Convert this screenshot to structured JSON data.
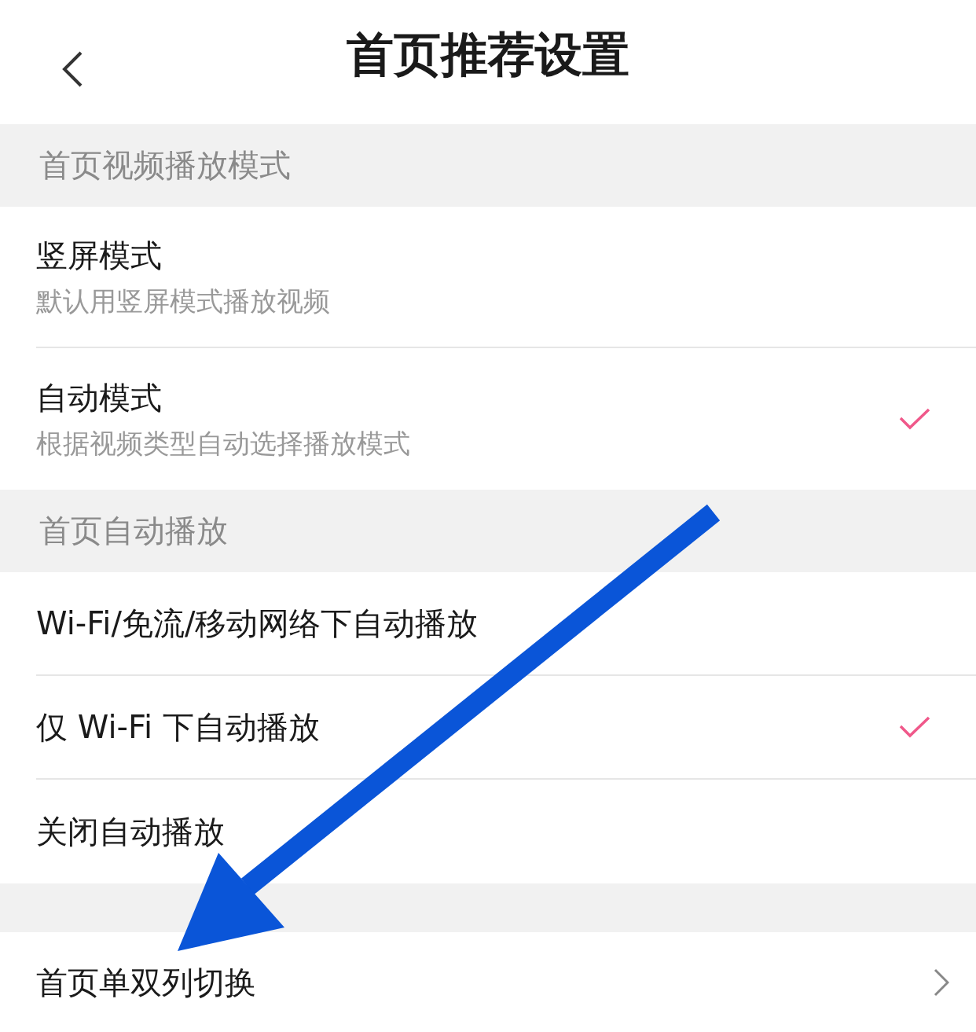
{
  "header": {
    "title": "首页推荐设置"
  },
  "sections": [
    {
      "header": "首页视频播放模式",
      "items": [
        {
          "kind": "choice",
          "title": "竖屏模式",
          "subtitle": "默认用竖屏模式播放视频",
          "selected": false
        },
        {
          "kind": "choice",
          "title": "自动模式",
          "subtitle": "根据视频类型自动选择播放模式",
          "selected": true
        }
      ]
    },
    {
      "header": "首页自动播放",
      "items": [
        {
          "kind": "choice",
          "title": "Wi-Fi/免流/移动网络下自动播放",
          "selected": false
        },
        {
          "kind": "choice",
          "title": "仅 Wi-Fi 下自动播放",
          "selected": true
        },
        {
          "kind": "choice",
          "title": "关闭自动播放",
          "selected": false
        }
      ]
    },
    {
      "items": [
        {
          "kind": "link",
          "title": "首页单双列切换"
        }
      ]
    }
  ]
}
